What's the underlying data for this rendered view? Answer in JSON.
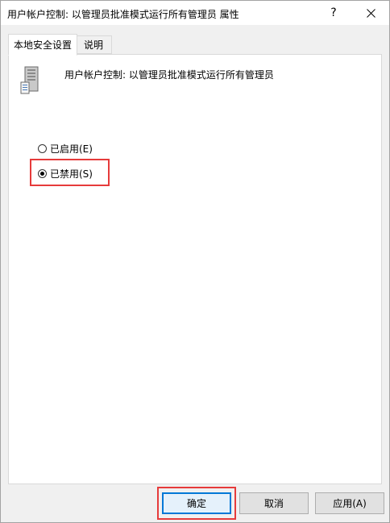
{
  "window": {
    "title": "用户帐户控制: 以管理员批准模式运行所有管理员 属性",
    "help_glyph": "?",
    "close_icon": "close-icon"
  },
  "tabs": [
    {
      "label": "本地安全设置",
      "active": true
    },
    {
      "label": "说明",
      "active": false
    }
  ],
  "policy": {
    "icon": "server-policy-icon",
    "title": "用户帐户控制: 以管理员批准模式运行所有管理员"
  },
  "options": [
    {
      "label": "已启用(E)",
      "checked": false
    },
    {
      "label": "已禁用(S)",
      "checked": true
    }
  ],
  "buttons": {
    "ok": "确定",
    "cancel": "取消",
    "apply": "应用(A)"
  },
  "colors": {
    "highlight": "#e63b3b",
    "focus": "#0078d7"
  }
}
